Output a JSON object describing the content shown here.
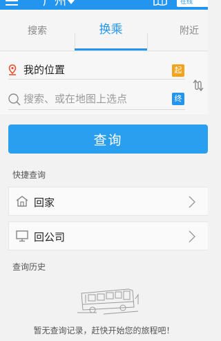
{
  "topbar": {
    "city": "广州",
    "status": "在线"
  },
  "tabs": [
    {
      "label": "搜索",
      "active": false
    },
    {
      "label": "换乘",
      "active": true
    },
    {
      "label": "附近",
      "active": false
    }
  ],
  "route": {
    "from": "我的位置",
    "from_tag": "起",
    "to_placeholder": "搜索、或在地图上选点",
    "to_tag": "终"
  },
  "query_button": "查询",
  "shortcuts": {
    "title": "快捷查询",
    "items": [
      {
        "label": "回家",
        "icon": "house-icon"
      },
      {
        "label": "回公司",
        "icon": "monitor-icon"
      }
    ]
  },
  "history": {
    "title": "查询历史",
    "empty_message": "暂无查询记录，赶快开始您的旅程吧！"
  },
  "colors": {
    "accent": "#2395ee",
    "start_tag": "#f3a21b",
    "pin": "#e8502f"
  }
}
